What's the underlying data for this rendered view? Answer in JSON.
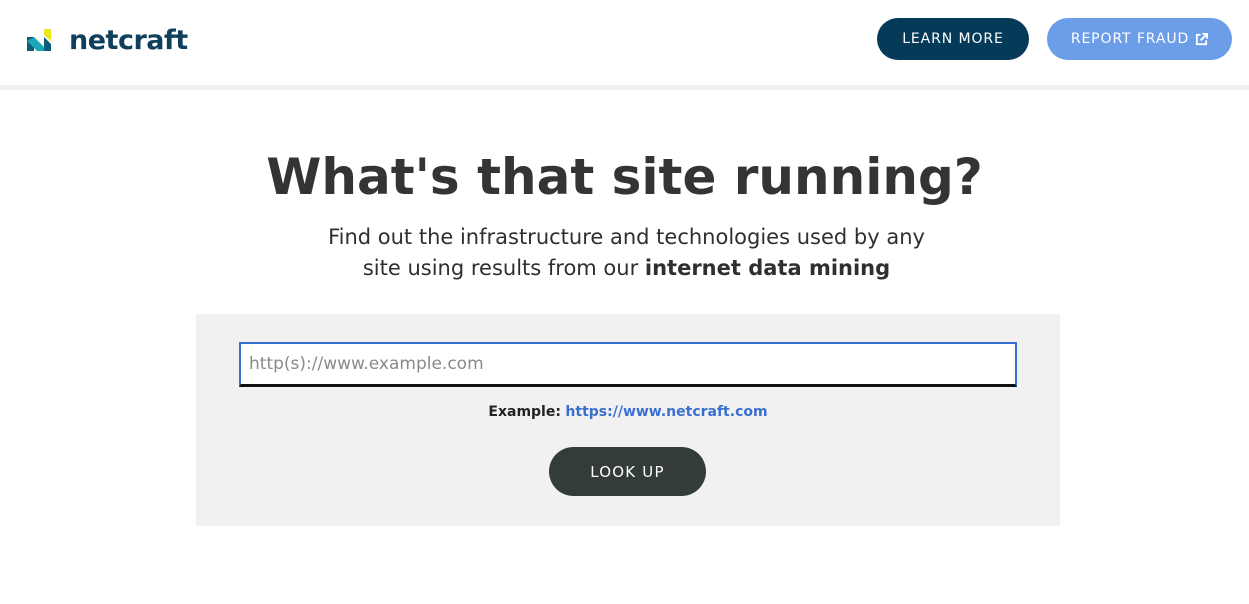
{
  "header": {
    "logo_text": "netcraft",
    "learn_more_label": "LEARN MORE",
    "report_fraud_label": "REPORT FRAUD"
  },
  "hero": {
    "title": "What's that site running?",
    "subtitle_line1": "Find out the infrastructure and technologies used by any",
    "subtitle_line2_prefix": "site using results from our ",
    "subtitle_line2_strong": "internet data mining"
  },
  "search": {
    "placeholder": "http(s)://www.example.com",
    "value": "",
    "example_label": "Example:",
    "example_link": "https://www.netcraft.com",
    "lookup_label": "LOOK UP"
  },
  "colors": {
    "brand_navy": "#063a59",
    "report_blue": "#6b9de8",
    "link_blue": "#3a6fcf",
    "logo_yellow": "#e8e81a",
    "logo_teal": "#1aa6b7",
    "panel_grey": "#f1f1f1",
    "lookup_dark": "#333b3b"
  },
  "icons": {
    "logo_mark": "netcraft-logo-mark",
    "external_link": "external-link-icon"
  }
}
